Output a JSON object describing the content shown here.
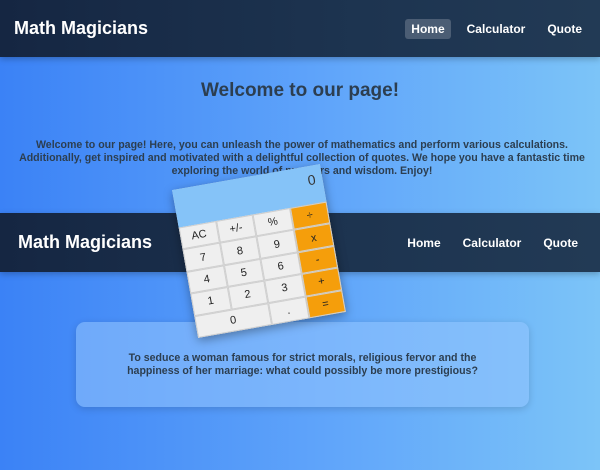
{
  "nav_top": {
    "brand": "Math Magicians",
    "links": [
      {
        "label": "Home"
      },
      {
        "label": "Calculator"
      },
      {
        "label": "Quote"
      }
    ]
  },
  "welcome": {
    "title": "Welcome to our page!",
    "text": "Welcome to our page! Here, you can unleash the power of mathematics and perform various calculations. Additionally, get inspired and motivated with a delightful collection of quotes. We hope you have a fantastic time exploring the world of numbers and wisdom. Enjoy!"
  },
  "nav_second": {
    "brand": "Math Magicians",
    "links": [
      {
        "label": "Home"
      },
      {
        "label": "Calculator"
      },
      {
        "label": "Quote"
      }
    ]
  },
  "calculator": {
    "display": "0",
    "keys": [
      "AC",
      "+/-",
      "%",
      "÷",
      "7",
      "8",
      "9",
      "x",
      "4",
      "5",
      "6",
      "-",
      "1",
      "2",
      "3",
      "+",
      "0",
      ".",
      "="
    ]
  },
  "quote": {
    "text": "To seduce a woman famous for strict morals, religious fervor and the happiness of her marriage: what could possibly be more prestigious?"
  },
  "colors": {
    "nav_bg": "#1a2e48",
    "operator_orange": "#f59e0b",
    "display_blue": "#85c3f8",
    "active_tab": "#4b5d74"
  }
}
